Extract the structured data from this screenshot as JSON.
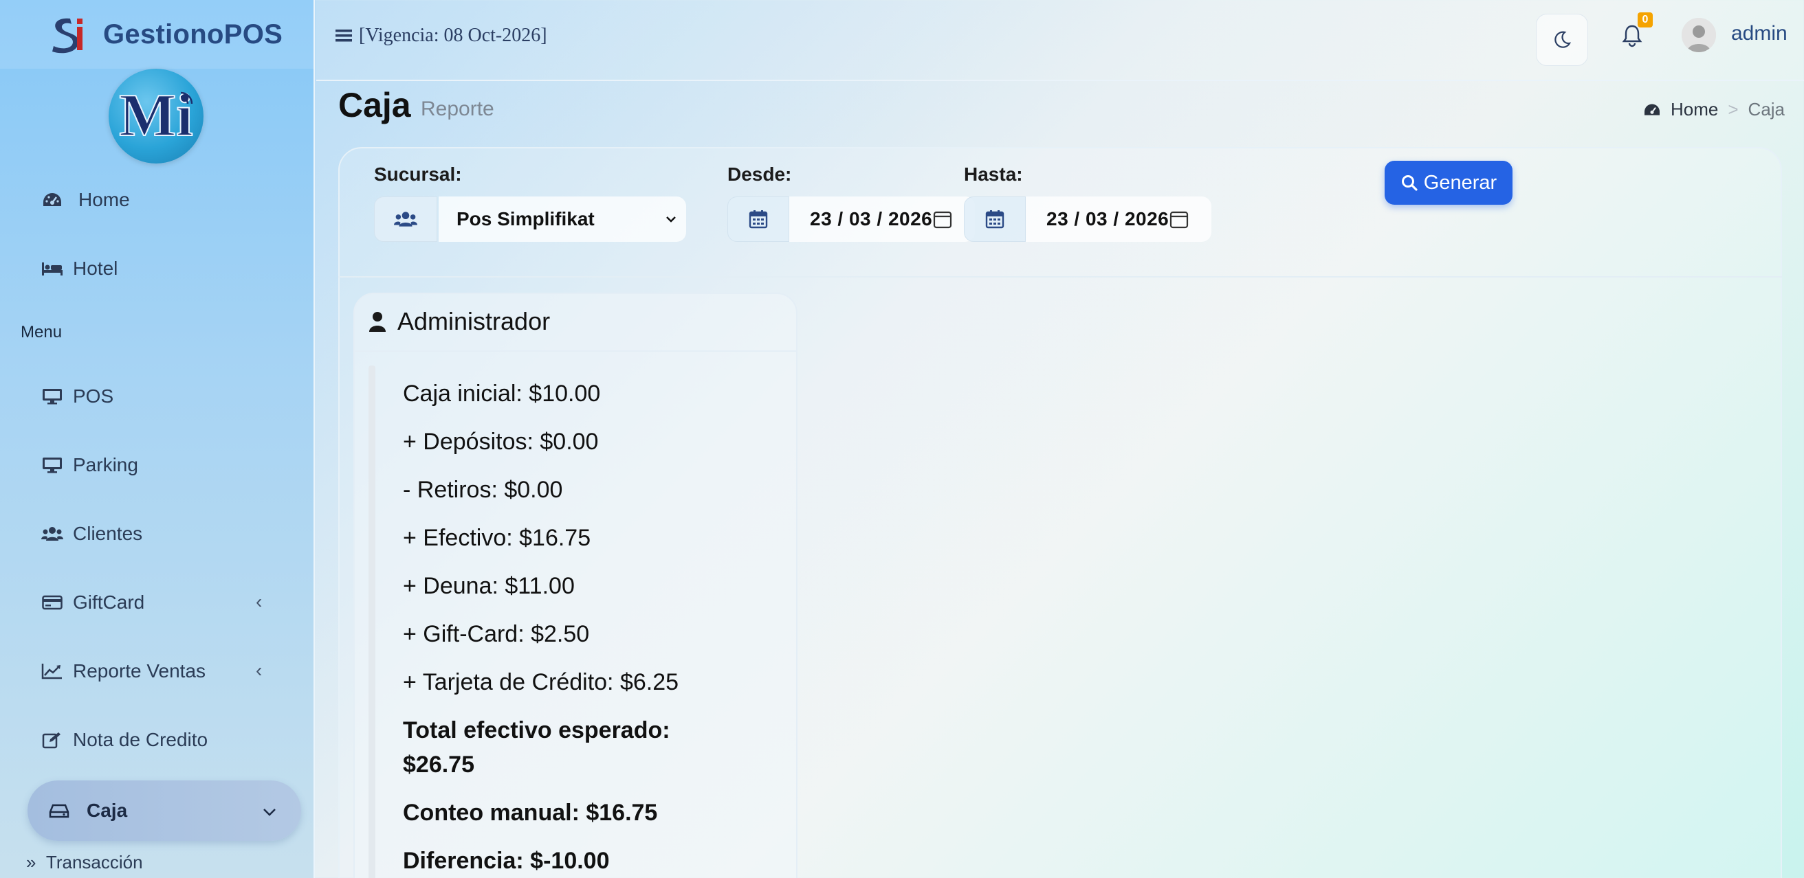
{
  "brand": {
    "name": "GestionoPOS",
    "logo_text": "Mi"
  },
  "topbar": {
    "vigencia": "[Vigencia: 08 Oct-2026]",
    "notifications": "0",
    "user": "admin"
  },
  "sidebar": {
    "items": [
      {
        "label": "Home"
      },
      {
        "label": "Hotel"
      },
      {
        "label": "POS"
      },
      {
        "label": "Parking"
      },
      {
        "label": "Clientes"
      },
      {
        "label": "GiftCard"
      },
      {
        "label": "Reporte Ventas"
      },
      {
        "label": "Nota de Credito"
      },
      {
        "label": "Caja"
      },
      {
        "label": "Transacción"
      }
    ],
    "menu_header": "Menu"
  },
  "page": {
    "title": "Caja",
    "subtitle": "Reporte"
  },
  "breadcrumb": {
    "home": "Home",
    "sep": ">",
    "current": "Caja"
  },
  "filters": {
    "sucursal_label": "Sucursal:",
    "sucursal_value": "Pos Simplifikat",
    "desde_label": "Desde:",
    "desde_value": "23 / 03 / 2026",
    "hasta_label": "Hasta:",
    "hasta_value": "23 / 03 / 2026",
    "generar": "Generar"
  },
  "admin": {
    "title": "Administrador",
    "lines": [
      "Caja inicial: $10.00",
      "+ Depósitos: $0.00",
      "- Retiros: $0.00",
      "+ Efectivo: $16.75",
      "+ Deuna: $11.00",
      "+ Gift-Card: $2.50",
      "+ Tarjeta de Crédito: $6.25",
      "Total efectivo esperado:",
      "$26.75",
      "Conteo manual: $16.75",
      "Diferencia: $-10.00"
    ]
  },
  "colors": {
    "accent": "#2563e4",
    "badge": "#f5a300",
    "brand": "#274a82"
  }
}
